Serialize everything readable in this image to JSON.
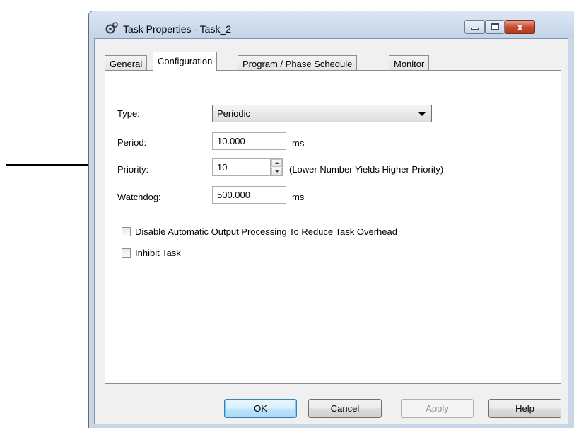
{
  "window": {
    "title": "Task Properties - Task_2",
    "icons": {
      "app": "task-gear-icon",
      "minimize": "minimize-icon",
      "maximize": "maximize-icon",
      "close": "close-icon"
    },
    "close_glyph": "x"
  },
  "tabs": [
    {
      "label": "General"
    },
    {
      "label": "Configuration"
    },
    {
      "label": "Program / Phase Schedule"
    },
    {
      "label": "Monitor"
    }
  ],
  "active_tab": "Configuration",
  "config": {
    "type_label": "Type:",
    "type_value": "Periodic",
    "period_label": "Period:",
    "period_value": "10.000",
    "period_unit": "ms",
    "priority_label": "Priority:",
    "priority_value": "10",
    "priority_hint": "(Lower Number Yields Higher Priority)",
    "watchdog_label": "Watchdog:",
    "watchdog_value": "500.000",
    "watchdog_unit": "ms",
    "disable_output_label": "Disable Automatic Output Processing To Reduce Task Overhead",
    "disable_output_checked": false,
    "inhibit_label": "Inhibit Task",
    "inhibit_checked": false
  },
  "buttons": {
    "ok": "OK",
    "cancel": "Cancel",
    "apply": "Apply",
    "help": "Help"
  },
  "colors": {
    "close_button": "#c34b2e",
    "default_button_border": "#3c7fb1"
  }
}
